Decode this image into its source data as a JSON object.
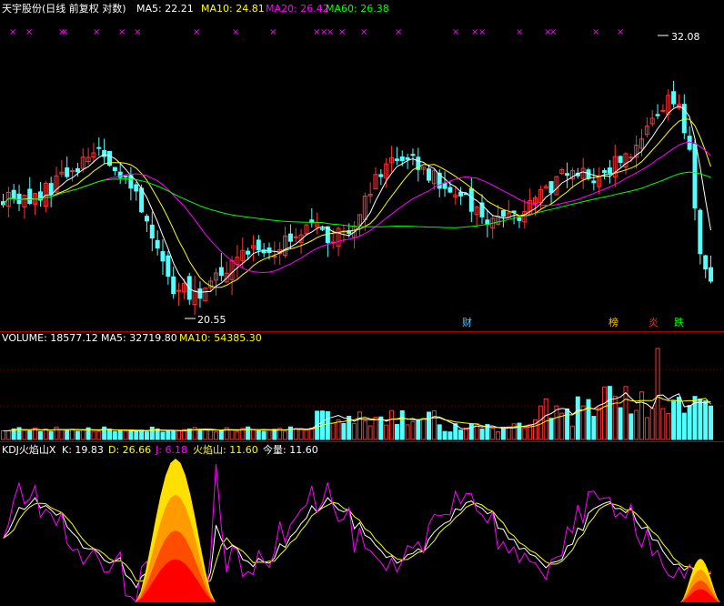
{
  "colors": {
    "bg": "#000000",
    "up": "#ff3232",
    "down": "#54ffff",
    "ma5": "#ffffff",
    "ma10": "#ffff00",
    "ma20": "#ff00ff",
    "ma60": "#00ff00",
    "separator": "#b00000",
    "kdj_k": "#ffffff",
    "kdj_d": "#ffff00",
    "kdj_j": "#ff00ff"
  },
  "price_panel": {
    "title": "天宇股份(日线 前复权 对数)",
    "ma5_label": "MA5: 22.21",
    "ma10_label": "MA10: 24.81",
    "ma20_label": "MA20: 26.42",
    "ma60_label": "MA60: 26.38",
    "high_label": "32.08",
    "low_label": "20.55",
    "event_marks": [
      {
        "label": "财",
        "color": "#5cc6ff"
      },
      {
        "label": "榜",
        "color": "#ffc000"
      },
      {
        "label": "炎",
        "color": "#ff3030"
      },
      {
        "label": "跌",
        "color": "#00ff00"
      }
    ],
    "x_mark_glyph": "×"
  },
  "volume_panel": {
    "label": "VOLUME: 18577.12",
    "ma5_label": "MA5: 32719.80",
    "ma10_label": "MA10: 54385.30"
  },
  "kdj_panel": {
    "name": "KDJ火焰山X",
    "k_label": "K: 19.83",
    "d_label": "D: 26.66",
    "j_label": "J: 6.18",
    "flame_label": "火焰山: 11.60",
    "today_label": "今量: 11.60"
  },
  "chart_data": [
    {
      "type": "candlestick",
      "title": "天宇股份(日线 前复权 对数)",
      "series": [
        {
          "name": "MA5",
          "last": 22.21
        },
        {
          "name": "MA10",
          "last": 24.81
        },
        {
          "name": "MA20",
          "last": 26.42
        },
        {
          "name": "MA60",
          "last": 26.38
        }
      ],
      "annotations": [
        {
          "text": "32.08",
          "note": "period high"
        },
        {
          "text": "20.55",
          "note": "period low"
        }
      ],
      "waypoints_close": [
        [
          0,
          24.6
        ],
        [
          6,
          24.4
        ],
        [
          12,
          25.6
        ],
        [
          18,
          26.6
        ],
        [
          22,
          25.6
        ],
        [
          27,
          23.8
        ],
        [
          31,
          21.4
        ],
        [
          35,
          20.8
        ],
        [
          40,
          21.5
        ],
        [
          45,
          22.3
        ],
        [
          50,
          22.4
        ],
        [
          54,
          23.0
        ],
        [
          58,
          23.4
        ],
        [
          62,
          23.0
        ],
        [
          66,
          23.6
        ],
        [
          70,
          25.2
        ],
        [
          74,
          26.2
        ],
        [
          78,
          26.0
        ],
        [
          82,
          25.2
        ],
        [
          86,
          24.8
        ],
        [
          90,
          23.8
        ],
        [
          94,
          23.7
        ],
        [
          98,
          24.0
        ],
        [
          102,
          24.9
        ],
        [
          106,
          25.6
        ],
        [
          110,
          25.4
        ],
        [
          114,
          25.8
        ],
        [
          118,
          26.4
        ],
        [
          122,
          27.8
        ],
        [
          125,
          29.0
        ],
        [
          127,
          28.5
        ],
        [
          129,
          26.3
        ],
        [
          131,
          22.5
        ],
        [
          133,
          21.6
        ]
      ]
    },
    {
      "type": "bar",
      "title": "VOLUME",
      "series": [
        {
          "name": "VOLUME",
          "last": 18577.12
        },
        {
          "name": "MA5",
          "last": 32719.8
        },
        {
          "name": "MA10",
          "last": 54385.3
        }
      ]
    },
    {
      "type": "line",
      "title": "KDJ火焰山X",
      "series": [
        {
          "name": "K",
          "last": 19.83
        },
        {
          "name": "D",
          "last": 26.66
        },
        {
          "name": "J",
          "last": 6.18
        },
        {
          "name": "火焰山",
          "last": 11.6
        },
        {
          "name": "今量",
          "last": 11.6
        }
      ]
    }
  ]
}
